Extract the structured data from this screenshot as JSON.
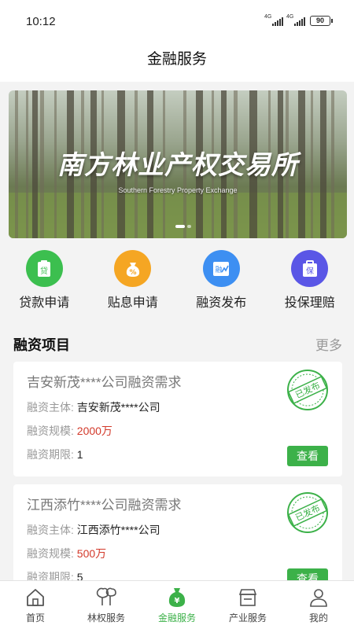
{
  "status_bar": {
    "time": "10:12",
    "signal1": "4G",
    "signal2": "4G",
    "battery": "90"
  },
  "header": {
    "title": "金融服务"
  },
  "banner": {
    "title": "南方林业产权交易所",
    "subtitle": "Southern Forestry Property Exchange"
  },
  "quick_actions": [
    {
      "label": "贷款申请",
      "icon": "loan-icon",
      "color": "#3cbf4f",
      "glyph": "贷"
    },
    {
      "label": "贴息申请",
      "icon": "money-bag-icon",
      "color": "#f5a623",
      "glyph": "%"
    },
    {
      "label": "融资发布",
      "icon": "financing-icon",
      "color": "#3d8ff2",
      "glyph": "融"
    },
    {
      "label": "投保理赔",
      "icon": "insurance-icon",
      "color": "#5a56e6",
      "glyph": "保"
    }
  ],
  "section": {
    "title": "融资项目",
    "more": "更多"
  },
  "projects": [
    {
      "title": "吉安新茂****公司融资需求",
      "subject_label": "融资主体:",
      "subject": "吉安新茂****公司",
      "scale_label": "融资规模:",
      "scale": "2000万",
      "term_label": "融资期限:",
      "term": "1",
      "stamp": "已发布",
      "button": "查看"
    },
    {
      "title": "江西添竹****公司融资需求",
      "subject_label": "融资主体:",
      "subject": "江西添竹****公司",
      "scale_label": "融资规模:",
      "scale": "500万",
      "term_label": "融资期限:",
      "term": "5",
      "stamp": "已发布",
      "button": "查看"
    }
  ],
  "tabbar": [
    {
      "label": "首页",
      "icon": "home-icon"
    },
    {
      "label": "林权服务",
      "icon": "tree-icon"
    },
    {
      "label": "金融服务",
      "icon": "money-bag-icon",
      "active": true
    },
    {
      "label": "产业服务",
      "icon": "store-icon"
    },
    {
      "label": "我的",
      "icon": "user-icon"
    }
  ],
  "colors": {
    "accent": "#3cb149",
    "red": "#d33a2b"
  }
}
